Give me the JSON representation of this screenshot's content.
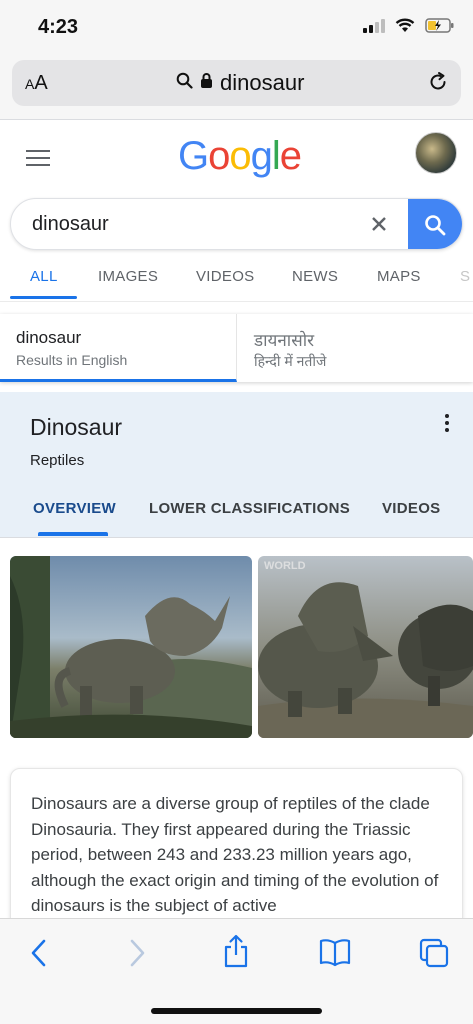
{
  "status": {
    "time": "4:23"
  },
  "safari": {
    "aa_label_small": "A",
    "aa_label_large": "A",
    "url": "dinosaur"
  },
  "google": {
    "logo": [
      "G",
      "o",
      "o",
      "g",
      "l",
      "e"
    ],
    "logo_colors": [
      "#4285f4",
      "#ea4335",
      "#fbbc05",
      "#4285f4",
      "#34a853",
      "#ea4335"
    ],
    "search_value": "dinosaur"
  },
  "tabs": [
    "ALL",
    "IMAGES",
    "VIDEOS",
    "NEWS",
    "MAPS",
    "S"
  ],
  "language": [
    {
      "title": "dinosaur",
      "subtitle": "Results in English"
    },
    {
      "title": "डायनासोर",
      "subtitle": "हिन्दी में नतीजे"
    }
  ],
  "knowledge_panel": {
    "title": "Dinosaur",
    "subtitle": "Reptiles",
    "tabs": [
      "OVERVIEW",
      "LOWER CLASSIFICATIONS",
      "VIDEOS"
    ]
  },
  "images": [
    {
      "watermark": ""
    },
    {
      "watermark": "WORLD"
    }
  ],
  "description": "Dinosaurs are a diverse group of reptiles of the clade Dinosauria. They first appeared during the Triassic period, between 243 and 233.23 million years ago, although the exact origin and timing of the evolution of dinosaurs is the subject of active",
  "colors": {
    "accent": "#1a73e8",
    "search_button": "#4285f4",
    "toolbar_active": "#1a73e8",
    "toolbar_disabled": "#b9c9df"
  }
}
